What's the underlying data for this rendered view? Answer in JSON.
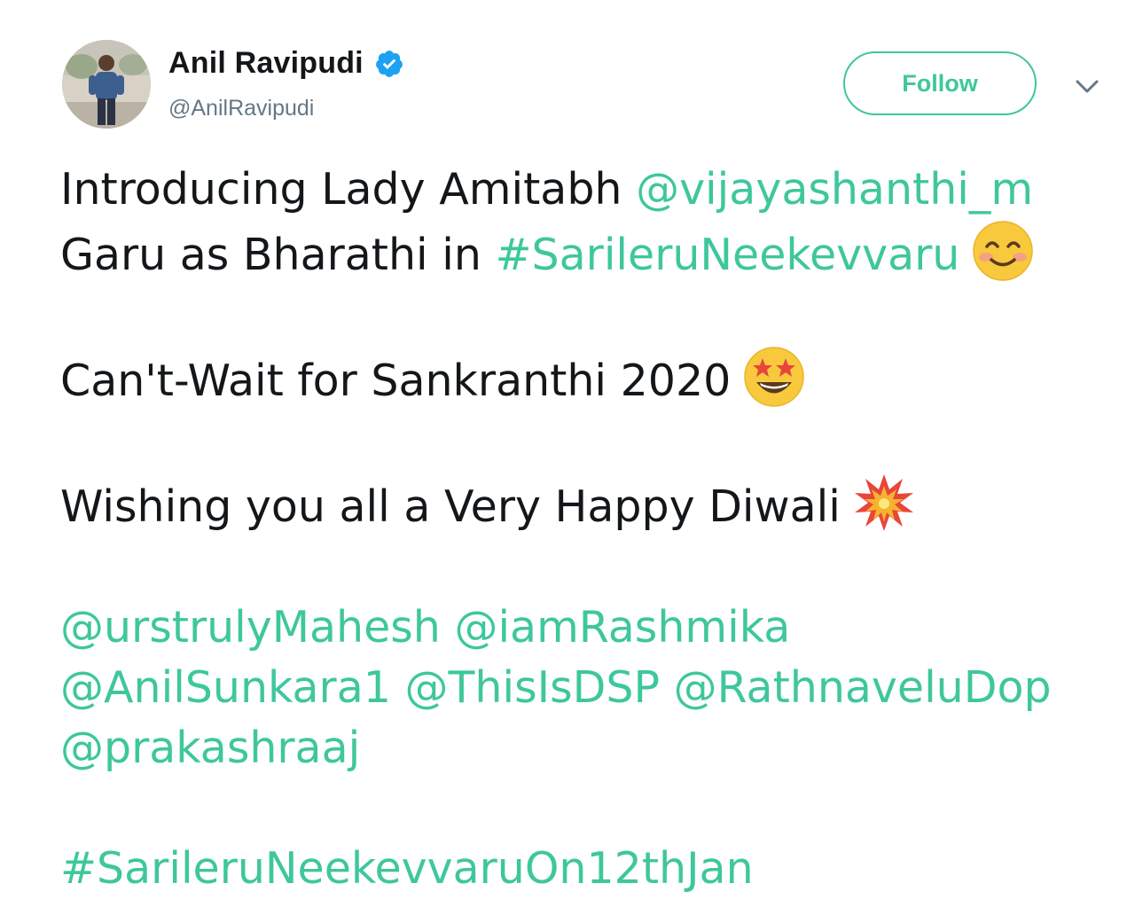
{
  "author": {
    "display_name": "Anil Ravipudi",
    "handle": "@AnilRavipudi",
    "verified": true,
    "verified_icon": "verified-badge-icon"
  },
  "actions": {
    "follow_label": "Follow",
    "more_icon": "chevron-down-icon"
  },
  "tweet": {
    "line1_text": "Introducing Lady Amitabh ",
    "line1_mention": "@vijayashanthi_m",
    "line2_text": "Garu as Bharathi in ",
    "line2_hashtag": "#SarileruNeekevvaru",
    "line2_emoji": "smiling-face-with-smiling-eyes-emoji",
    "para2_text": "Can't-Wait for Sankranthi 2020",
    "para2_emoji": "star-struck-emoji",
    "para3_text": "Wishing you all a Very Happy Diwali",
    "para3_emoji": "collision-emoji",
    "mentions_line1": [
      "@urstrulyMahesh",
      "@iamRashmika"
    ],
    "mentions_line2": [
      "@AnilSunkara1",
      "@ThisIsDSP",
      "@RathnaveluDop"
    ],
    "mentions_line3": [
      "@prakashraaj"
    ],
    "final_hashtag": "#SarileruNeekevvaruOn12thJan"
  },
  "colors": {
    "accent": "#3ec79c",
    "text": "#14171a",
    "secondary": "#657786",
    "verified": "#1da1f2"
  }
}
